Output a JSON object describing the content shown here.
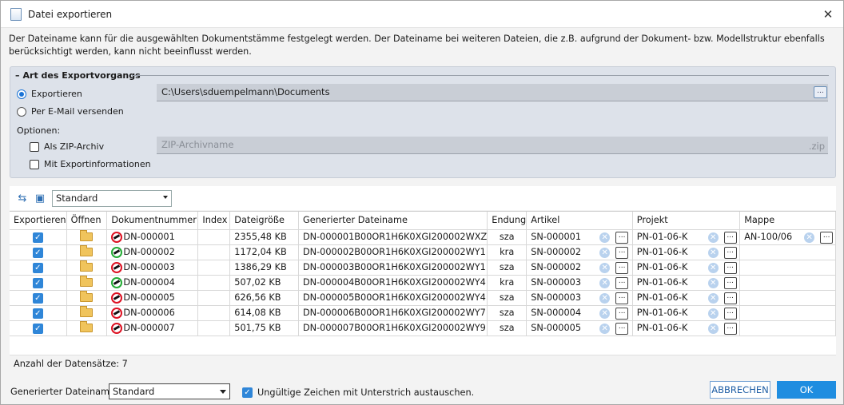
{
  "window": {
    "title": "Datei exportieren",
    "close_glyph": "✕"
  },
  "description": "Der Dateiname kann für die ausgewählten Dokumentstämme festgelegt werden. Der Dateiname bei weiteren Dateien, die z.B. aufgrund der Dokument- bzw. Modellstruktur ebenfalls berücksichtigt werden, kann nicht beeinflusst werden.",
  "group": {
    "legend": "Art des Exportvorgangs",
    "legend_dash": "–",
    "radio_export": "Exportieren",
    "radio_email": "Per E-Mail versenden",
    "options_label": "Optionen:",
    "zip_label": "Als ZIP-Archiv",
    "info_label": "Mit Exportinformationen",
    "path_value": "C:\\Users\\sduempelmann\\Documents",
    "zip_placeholder": "ZIP-Archivname",
    "zip_ext": ".zip",
    "dots": "..."
  },
  "toolbar": {
    "profile": "Standard"
  },
  "table": {
    "headers": [
      "Exportieren",
      "Öffnen",
      "Dokumentnummer",
      "Index",
      "Dateigröße",
      "Generierter Dateiname",
      "Endung",
      "Artikel",
      "Projekt",
      "Mappe"
    ],
    "rows": [
      {
        "doc": "DN-000001",
        "size": "2355,48 KB",
        "gen": "DN-000001B00OR1H6K0XGI200002WXZ",
        "ext": "sza",
        "artikel": "SN-000001",
        "projekt": "PN-01-06-K",
        "mappe": "AN-100/06",
        "icon": "red"
      },
      {
        "doc": "DN-000002",
        "size": "1172,04 KB",
        "gen": "DN-000002B00OR1H6K0XGI200002WY1",
        "ext": "kra",
        "artikel": "SN-000002",
        "projekt": "PN-01-06-K",
        "mappe": "",
        "icon": "green"
      },
      {
        "doc": "DN-000003",
        "size": "1386,29 KB",
        "gen": "DN-000003B00OR1H6K0XGI200002WY1",
        "ext": "sza",
        "artikel": "SN-000002",
        "projekt": "PN-01-06-K",
        "mappe": "",
        "icon": "red"
      },
      {
        "doc": "DN-000004",
        "size": "507,02 KB",
        "gen": "DN-000004B00OR1H6K0XGI200002WY4",
        "ext": "kra",
        "artikel": "SN-000003",
        "projekt": "PN-01-06-K",
        "mappe": "",
        "icon": "green"
      },
      {
        "doc": "DN-000005",
        "size": "626,56 KB",
        "gen": "DN-000005B00OR1H6K0XGI200002WY4",
        "ext": "sza",
        "artikel": "SN-000003",
        "projekt": "PN-01-06-K",
        "mappe": "",
        "icon": "red"
      },
      {
        "doc": "DN-000006",
        "size": "614,08 KB",
        "gen": "DN-000006B00OR1H6K0XGI200002WY7",
        "ext": "sza",
        "artikel": "SN-000004",
        "projekt": "PN-01-06-K",
        "mappe": "",
        "icon": "red"
      },
      {
        "doc": "DN-000007",
        "size": "501,75 KB",
        "gen": "DN-000007B00OR1H6K0XGI200002WY9",
        "ext": "sza",
        "artikel": "SN-000005",
        "projekt": "PN-01-06-K",
        "mappe": "",
        "icon": "red"
      }
    ]
  },
  "record_count": "Anzahl der Datensätze: 7",
  "bottom": {
    "gen_label": "Generierter Dateiname:",
    "gen_value": "Standard",
    "underscore_label": "Ungültige Zeichen mit Unterstrich austauschen.",
    "cancel": "ABBRECHEN",
    "ok": "OK"
  },
  "colors": {
    "accent": "#1f8de0",
    "check": "#2f86d8",
    "group_bg": "#dde2ea"
  }
}
